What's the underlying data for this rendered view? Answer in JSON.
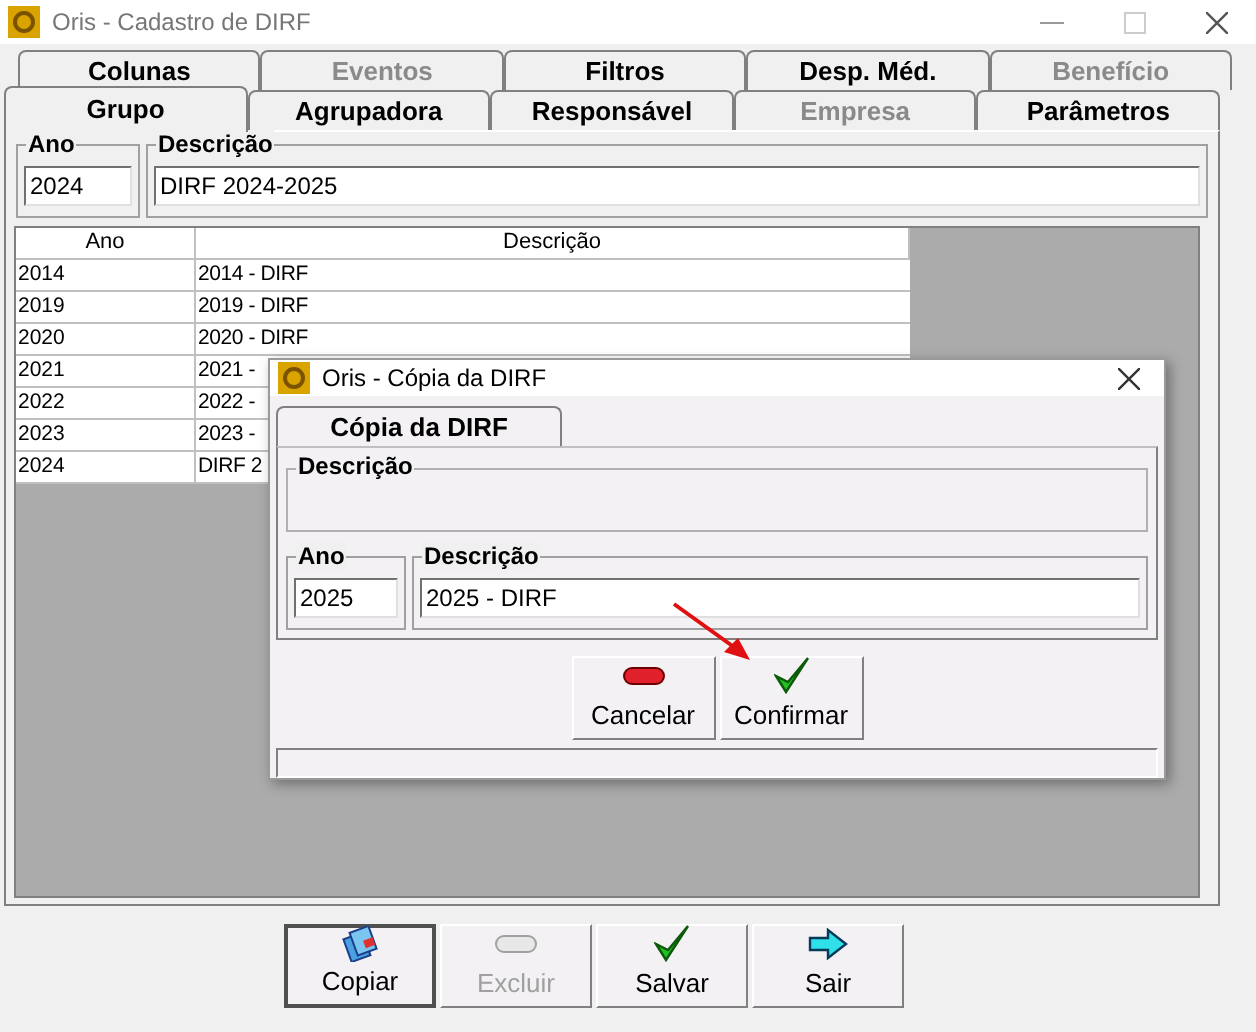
{
  "window": {
    "title": "Oris - Cadastro de DIRF"
  },
  "tab_rows": [
    [
      {
        "label": "Colunas",
        "selected": false,
        "disabled": false
      },
      {
        "label": "Eventos",
        "selected": false,
        "disabled": true
      },
      {
        "label": "Filtros",
        "selected": false,
        "disabled": false
      },
      {
        "label": "Desp. Méd.",
        "selected": false,
        "disabled": false
      },
      {
        "label": "Benefício",
        "selected": false,
        "disabled": true
      }
    ],
    [
      {
        "label": "Grupo",
        "selected": true,
        "disabled": false
      },
      {
        "label": "Agrupadora",
        "selected": false,
        "disabled": false
      },
      {
        "label": "Responsável",
        "selected": false,
        "disabled": false
      },
      {
        "label": "Empresa",
        "selected": false,
        "disabled": true
      },
      {
        "label": "Parâmetros",
        "selected": false,
        "disabled": false
      }
    ]
  ],
  "fields": {
    "ano": {
      "label": "Ano",
      "value": "2024"
    },
    "descricao": {
      "label": "Descrição",
      "value": "DIRF 2024-2025"
    }
  },
  "table": {
    "columns": [
      "Ano",
      "Descrição"
    ],
    "rows": [
      {
        "ano": "2014",
        "descricao": "2014 - DIRF"
      },
      {
        "ano": "2019",
        "descricao": "2019 - DIRF"
      },
      {
        "ano": "2020",
        "descricao": "2020 - DIRF"
      },
      {
        "ano": "2021",
        "descricao": "2021 -"
      },
      {
        "ano": "2022",
        "descricao": "2022 -"
      },
      {
        "ano": "2023",
        "descricao": "2023 -"
      },
      {
        "ano": "2024",
        "descricao": "DIRF 2"
      }
    ]
  },
  "buttons": [
    {
      "label": "Copiar",
      "kind": "copy",
      "disabled": false,
      "focused": true
    },
    {
      "label": "Excluir",
      "kind": "minus",
      "disabled": true,
      "focused": false
    },
    {
      "label": "Salvar",
      "kind": "check",
      "disabled": false,
      "focused": false
    },
    {
      "label": "Sair",
      "kind": "exit",
      "disabled": false,
      "focused": false
    }
  ],
  "dialog": {
    "title": "Oris - Cópia da DIRF",
    "tab": {
      "label": "Cópia da DIRF",
      "selected": true
    },
    "group_label": "Descrição",
    "fields": {
      "ano": {
        "label": "Ano",
        "value": "2025"
      },
      "descricao": {
        "label": "Descrição",
        "value": "2025 - DIRF"
      }
    },
    "buttons": [
      {
        "label": "Cancelar",
        "kind": "minus",
        "disabled": false,
        "focused": false
      },
      {
        "label": "Confirmar",
        "kind": "check",
        "disabled": false,
        "focused": false
      }
    ]
  }
}
